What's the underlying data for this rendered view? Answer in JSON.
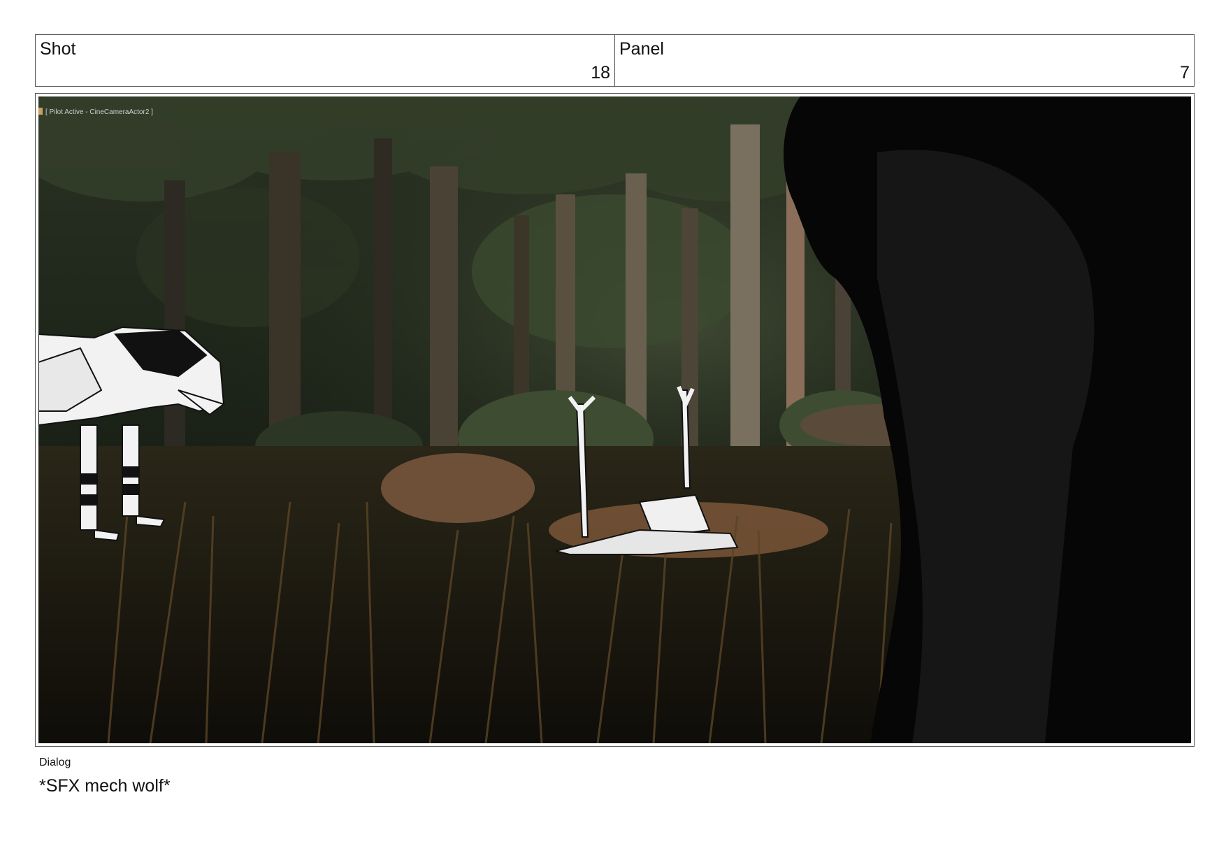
{
  "header": {
    "shot_label": "Shot",
    "shot_value": "18",
    "panel_label": "Panel",
    "panel_value": "7"
  },
  "frame": {
    "overlay_text": "[ Pilot Active - CineCameraActor2 ]",
    "colors": {
      "forest_dark": "#1a2016",
      "foliage": "#3d4a2c",
      "grass": "#4a3a22",
      "rock": "#7a5a3c",
      "silhouette": "#050505"
    }
  },
  "dialog": {
    "label": "Dialog",
    "text": "*SFX mech wolf*"
  }
}
